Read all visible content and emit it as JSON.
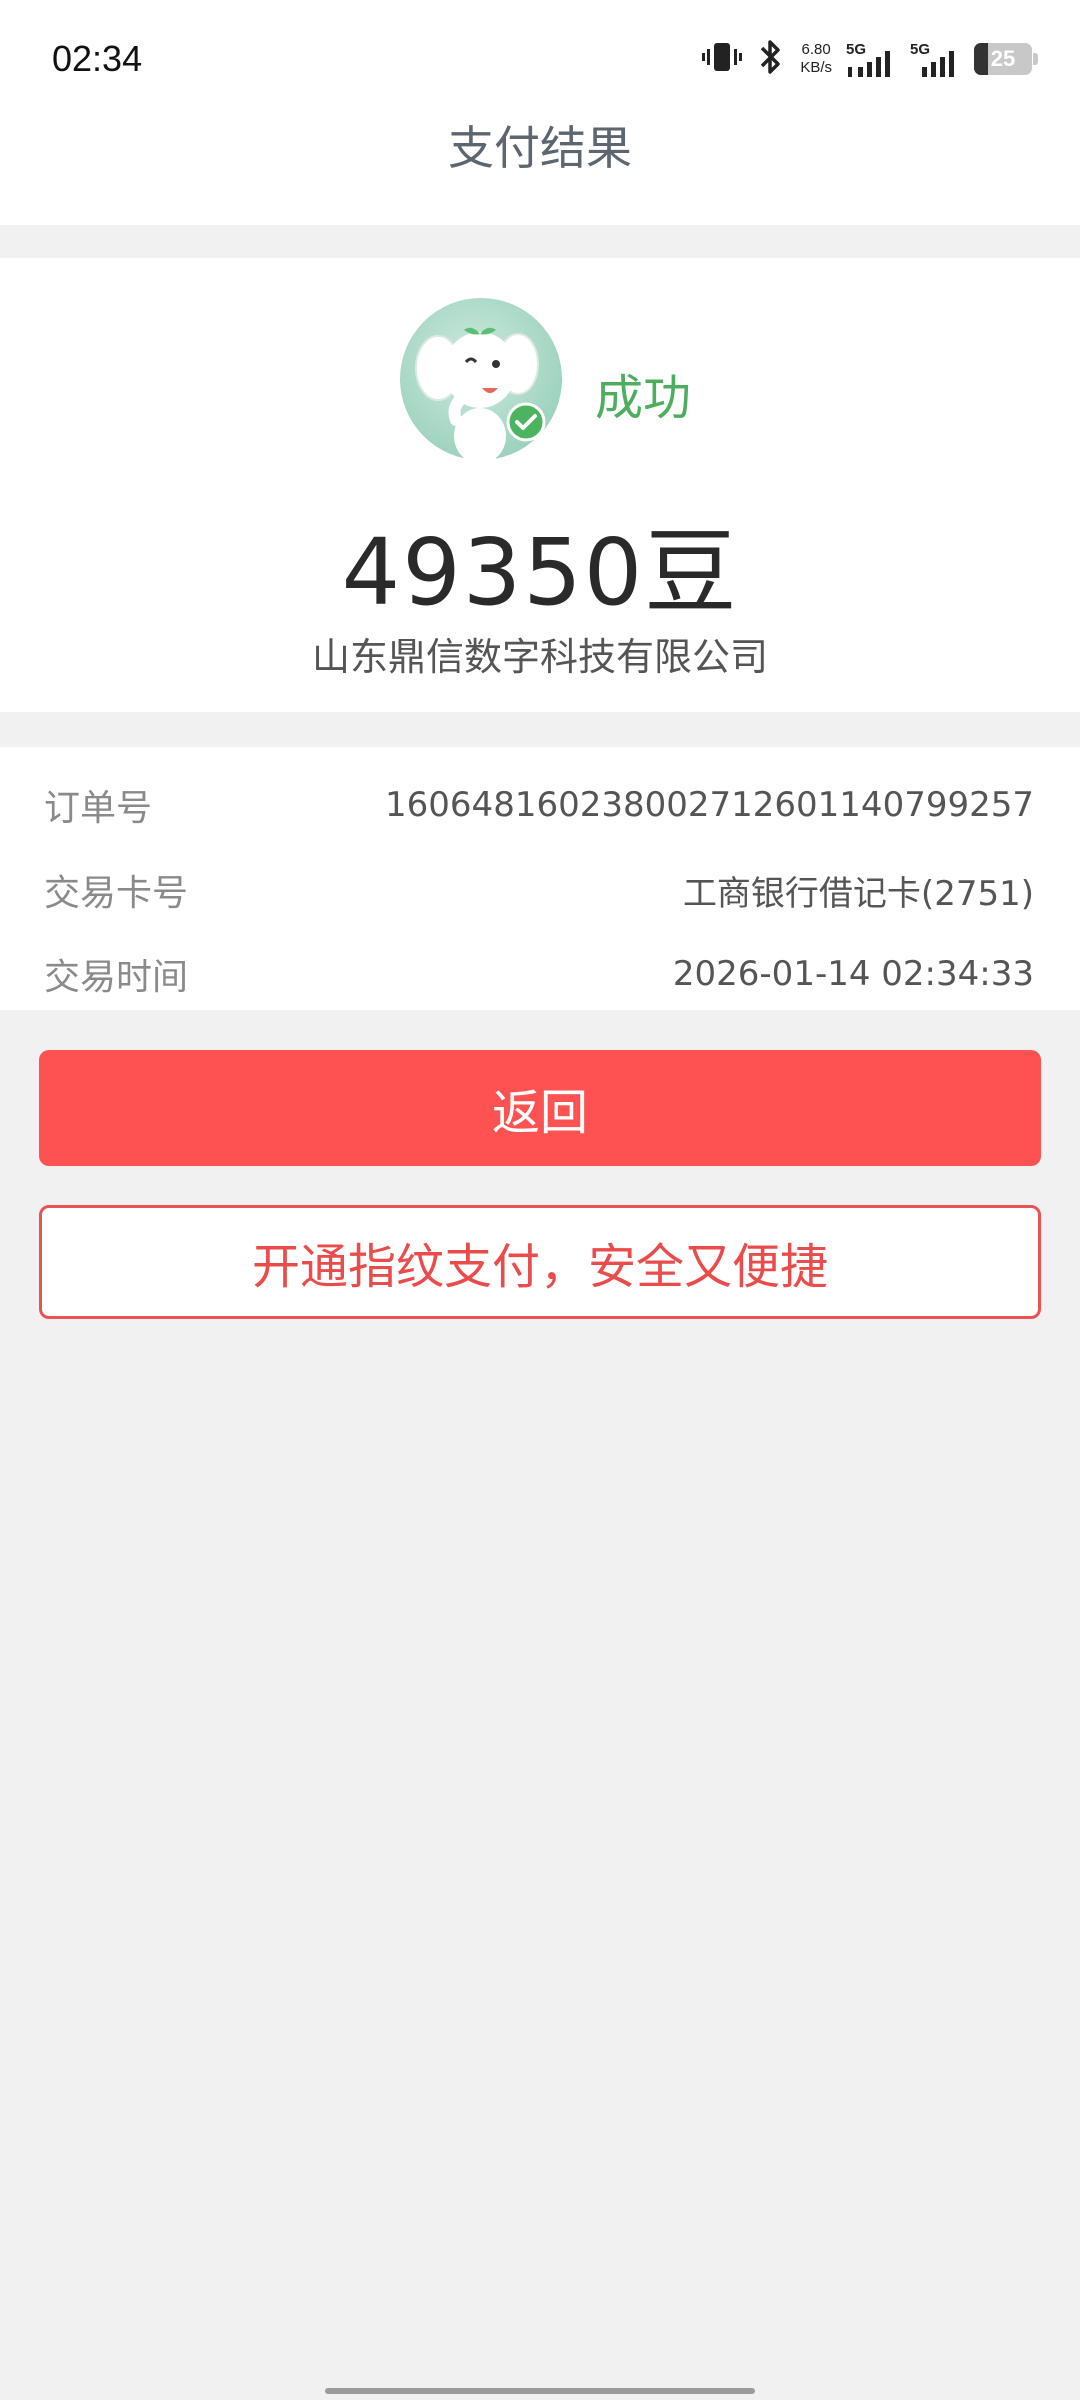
{
  "status_bar": {
    "time": "02:34",
    "net_speed_value": "6.80",
    "net_speed_unit": "KB/s",
    "sim1_label": "5G",
    "sim2_label": "5G",
    "battery": "25"
  },
  "header": {
    "title": "支付结果"
  },
  "result": {
    "status": "成功",
    "amount": "49350豆",
    "merchant": "山东鼎信数字科技有限公司"
  },
  "details": [
    {
      "label": "订单号",
      "value": "1606481602380027126011407992​57"
    },
    {
      "label": "交易卡号",
      "value": "工商银行借记卡(2751)"
    },
    {
      "label": "交易时间",
      "value": "2026-01-14 02:34:33"
    }
  ],
  "actions": {
    "back_label": "返回",
    "fingerprint_label": "开通指纹支付，安全又便捷"
  },
  "colors": {
    "primary_red": "#fc5352",
    "success_green": "#4cae5e"
  }
}
